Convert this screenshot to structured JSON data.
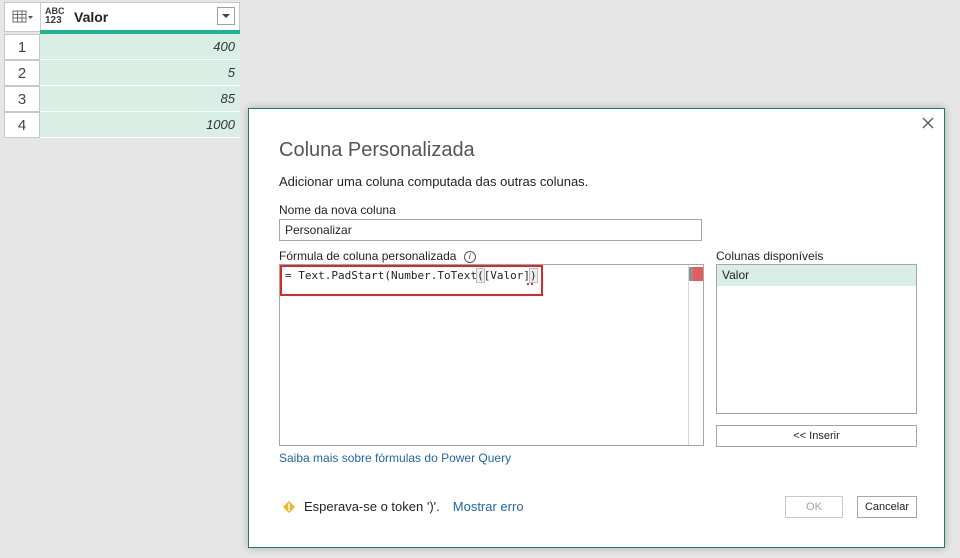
{
  "grid": {
    "column_type_top": "ABC",
    "column_type_bottom": "123",
    "column_name": "Valor",
    "rows": [
      {
        "num": "1",
        "value": "400"
      },
      {
        "num": "2",
        "value": "5"
      },
      {
        "num": "3",
        "value": "85"
      },
      {
        "num": "4",
        "value": "1000"
      }
    ],
    "quality_color": "#1fb394",
    "cell_color": "#d9efe6"
  },
  "dialog": {
    "title": "Coluna Personalizada",
    "description": "Adicionar uma coluna computada das outras colunas.",
    "name_label": "Nome da nova coluna",
    "name_value": "Personalizar",
    "formula_label": "Fórmula de coluna personalizada",
    "formula_prefix": "= Text.PadStart(Number.ToText",
    "formula_paren": "(",
    "formula_mid": "[Valor]",
    "formula_paren_close": ")",
    "learn_more": "Saiba mais sobre fórmulas do Power Query",
    "available_label": "Colunas disponíveis",
    "available_columns": [
      "Valor"
    ],
    "insert_button": "<< Inserir",
    "error_message": "Esperava-se o token ')'.",
    "show_error": "Mostrar erro",
    "ok_button": "OK",
    "cancel_button": "Cancelar",
    "accent_color": "#1e7f60",
    "error_color": "#d22b2b",
    "link_color": "#2266a5"
  }
}
